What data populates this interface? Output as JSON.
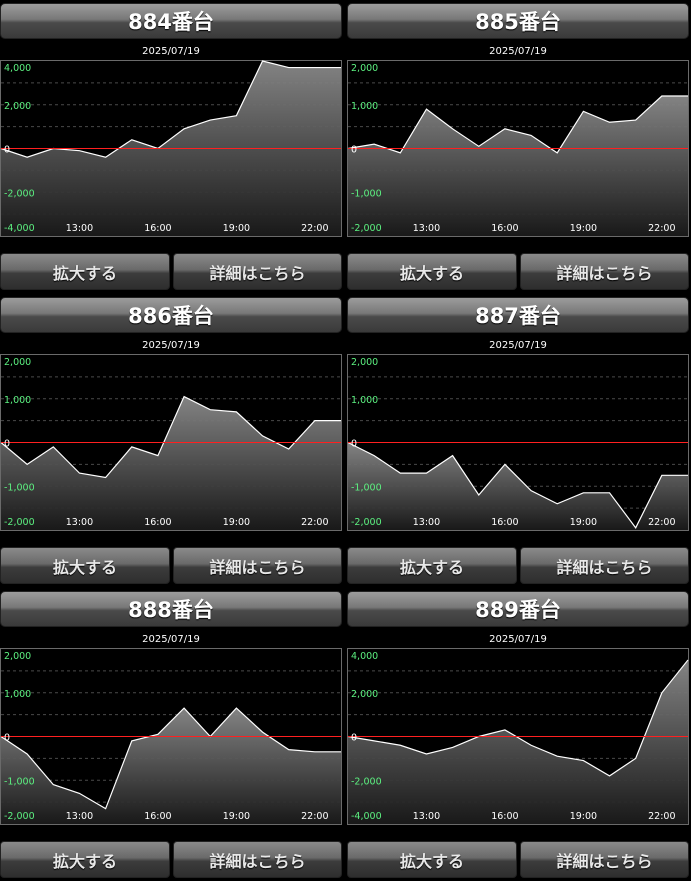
{
  "chart_data": [
    {
      "type": "area",
      "title": "884番台",
      "date": "2025/07/19",
      "yticks": [
        4000,
        2000,
        0,
        -2000,
        -4000
      ],
      "ytick_labels": [
        "4,000",
        "2,000",
        "0",
        "-2,000",
        "-4,000"
      ],
      "ylim": [
        -4000,
        4000
      ],
      "xticks": [
        "13:00",
        "16:00",
        "19:00",
        "22:00"
      ],
      "x_time_range": [
        "10:00",
        "23:00"
      ],
      "values": [
        0,
        -400,
        0,
        -100,
        -400,
        400,
        0,
        900,
        1300,
        1500,
        4000,
        3700,
        3700,
        3700
      ],
      "grid": true
    },
    {
      "type": "area",
      "title": "885番台",
      "date": "2025/07/19",
      "yticks": [
        2000,
        1000,
        0,
        -1000,
        -2000
      ],
      "ytick_labels": [
        "2,000",
        "1,000",
        "0",
        "-1,000",
        "-2,000"
      ],
      "ylim": [
        -2000,
        2000
      ],
      "xticks": [
        "13:00",
        "16:00",
        "19:00",
        "22:00"
      ],
      "x_time_range": [
        "10:00",
        "23:00"
      ],
      "values": [
        0,
        100,
        -100,
        900,
        450,
        50,
        450,
        300,
        -100,
        850,
        600,
        650,
        1200,
        1200
      ],
      "grid": true
    },
    {
      "type": "area",
      "title": "886番台",
      "date": "2025/07/19",
      "yticks": [
        2000,
        1000,
        0,
        -1000,
        -2000
      ],
      "ytick_labels": [
        "2,000",
        "1,000",
        "0",
        "-1,000",
        "-2,000"
      ],
      "ylim": [
        -2000,
        2000
      ],
      "xticks": [
        "13:00",
        "16:00",
        "19:00",
        "22:00"
      ],
      "x_time_range": [
        "10:00",
        "23:00"
      ],
      "values": [
        0,
        -500,
        -100,
        -700,
        -800,
        -100,
        -300,
        1050,
        750,
        700,
        150,
        -150,
        500,
        500
      ],
      "grid": true
    },
    {
      "type": "area",
      "title": "887番台",
      "date": "2025/07/19",
      "yticks": [
        2000,
        1000,
        0,
        -1000,
        -2000
      ],
      "ytick_labels": [
        "2,000",
        "1,000",
        "0",
        "-1,000",
        "-2,000"
      ],
      "ylim": [
        -2000,
        2000
      ],
      "xticks": [
        "13:00",
        "16:00",
        "19:00",
        "22:00"
      ],
      "x_time_range": [
        "10:00",
        "23:00"
      ],
      "values": [
        0,
        -300,
        -700,
        -700,
        -300,
        -1200,
        -500,
        -1100,
        -1400,
        -1150,
        -1150,
        -1950,
        -750,
        -750
      ],
      "grid": true
    },
    {
      "type": "area",
      "title": "888番台",
      "date": "2025/07/19",
      "yticks": [
        2000,
        1000,
        0,
        -1000,
        -2000
      ],
      "ytick_labels": [
        "2,000",
        "1,000",
        "0",
        "-1,000",
        "-2,000"
      ],
      "ylim": [
        -2000,
        2000
      ],
      "xticks": [
        "13:00",
        "16:00",
        "19:00",
        "22:00"
      ],
      "x_time_range": [
        "10:00",
        "23:00"
      ],
      "values": [
        0,
        -400,
        -1100,
        -1300,
        -1650,
        -100,
        50,
        650,
        0,
        650,
        100,
        -300,
        -350,
        -350
      ],
      "grid": true
    },
    {
      "type": "area",
      "title": "889番台",
      "date": "2025/07/19",
      "yticks": [
        4000,
        2000,
        0,
        -2000,
        -4000
      ],
      "ytick_labels": [
        "4,000",
        "2,000",
        "0",
        "-2,000",
        "-4,000"
      ],
      "ylim": [
        -4000,
        4000
      ],
      "xticks": [
        "13:00",
        "16:00",
        "19:00",
        "22:00"
      ],
      "x_time_range": [
        "10:00",
        "23:00"
      ],
      "values": [
        0,
        -200,
        -400,
        -800,
        -500,
        0,
        300,
        -400,
        -900,
        -1100,
        -1800,
        -1000,
        2000,
        3500
      ],
      "grid": true
    }
  ],
  "buttons": {
    "zoom": "拡大する",
    "detail": "詳細はこちら"
  },
  "colors": {
    "zero_line": "#ff2020",
    "tick_label": "#5cf080",
    "series_line": "#ffffff",
    "grid": "#4a4a4a"
  }
}
